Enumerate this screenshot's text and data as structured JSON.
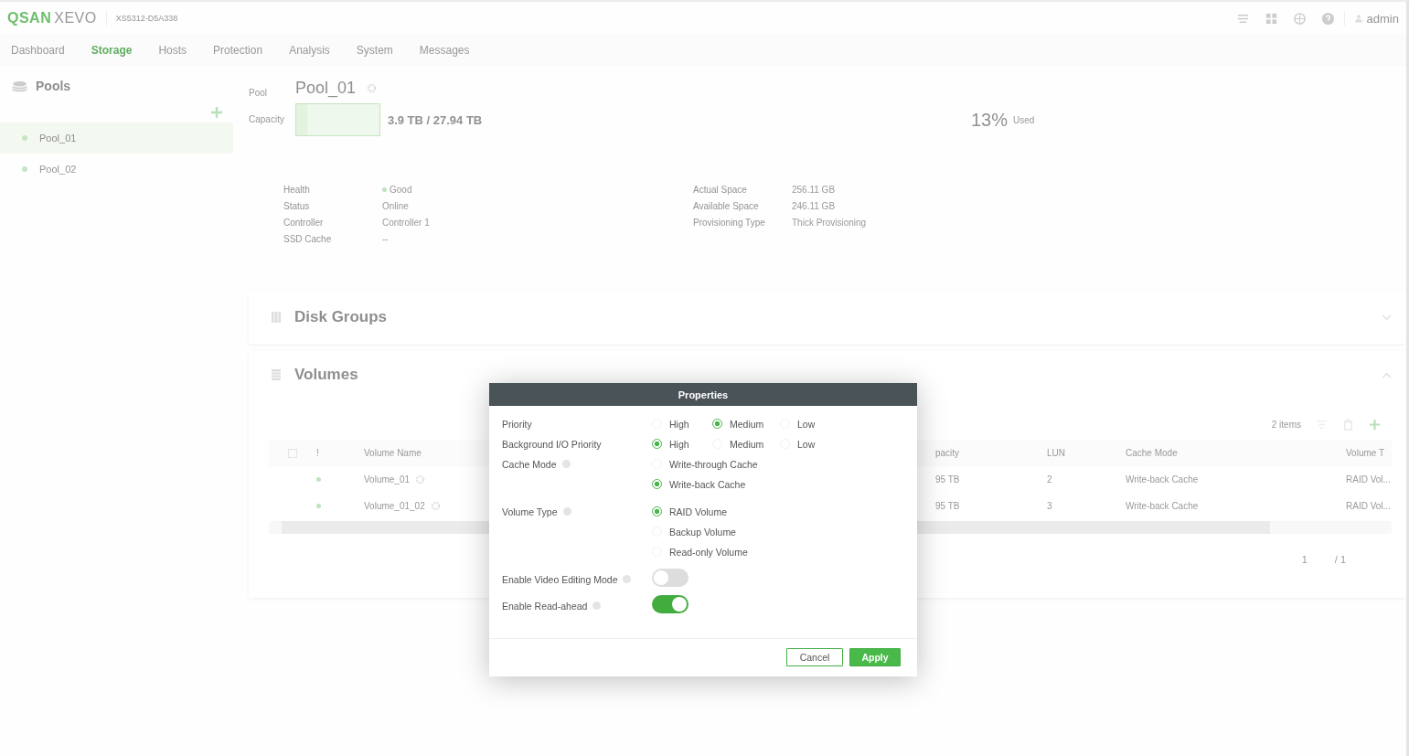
{
  "header": {
    "logo_part_1": "QSAN",
    "logo_part_2": "XEVO",
    "serial": "XS5312-D5A338",
    "user": "admin"
  },
  "nav": [
    {
      "label": "Dashboard",
      "selected": false
    },
    {
      "label": "Storage",
      "selected": true
    },
    {
      "label": "Hosts",
      "selected": false
    },
    {
      "label": "Protection",
      "selected": false
    },
    {
      "label": "Analysis",
      "selected": false
    },
    {
      "label": "System",
      "selected": false
    },
    {
      "label": "Messages",
      "selected": false
    }
  ],
  "sidebar": {
    "title": "Pools",
    "items": [
      {
        "label": "Pool_01",
        "selected": true
      },
      {
        "label": "Pool_02",
        "selected": false
      }
    ]
  },
  "pool": {
    "label": "Pool",
    "name": "Pool_01",
    "capacity_label": "Capacity",
    "level": 0.13,
    "capacity_text": "3.9 TB / 27.94 TB",
    "percent": "13%",
    "used_label": "Used",
    "details_left": [
      {
        "label": "Health",
        "value": "Good",
        "kind": "status"
      },
      {
        "label": "Status",
        "value": "Online",
        "kind": "text"
      },
      {
        "label": "Controller",
        "value": "Controller 1",
        "kind": "text"
      },
      {
        "label": "SSD Cache",
        "value": "--",
        "kind": "text"
      }
    ],
    "details_right": [
      {
        "label": "Actual Space",
        "value": "256.11 GB"
      },
      {
        "label": "Available Space",
        "value": "246.11 GB"
      },
      {
        "label": "Provisioning Type",
        "value": "Thick Provisioning"
      }
    ]
  },
  "disk_groups": {
    "title": "Disk Groups",
    "expanded": false
  },
  "volumes": {
    "title": "Volumes",
    "expanded": true,
    "item_count": "2 items",
    "select_all_checked": false,
    "columns": [
      "!",
      "Volume Name",
      "pacity",
      "LUN",
      "Cache Mode",
      "Volume T"
    ],
    "rows": [
      {
        "name": "Volume_01",
        "capacity": "95 TB",
        "lun": "2",
        "cache_mode": "Write-back Cache",
        "volume_type": "RAID Vol..."
      },
      {
        "name": "Volume_01_02",
        "capacity": "95 TB",
        "lun": "3",
        "cache_mode": "Write-back Cache",
        "volume_type": "RAID Vol..."
      }
    ],
    "page": "1",
    "page_total": "/ 1"
  },
  "dialog": {
    "title": "Properties",
    "fields": [
      {
        "kind": "radio-row",
        "label": "Priority",
        "help": false,
        "options": [
          {
            "label": "High",
            "selected": false
          },
          {
            "label": "Medium",
            "selected": true
          },
          {
            "label": "Low",
            "selected": false
          }
        ]
      },
      {
        "kind": "radio-row",
        "label": "Background I/O Priority",
        "help": false,
        "options": [
          {
            "label": "High",
            "selected": true
          },
          {
            "label": "Medium",
            "selected": false
          },
          {
            "label": "Low",
            "selected": false
          }
        ]
      },
      {
        "kind": "radio-column",
        "label": "Cache Mode",
        "help": true,
        "options": [
          {
            "label": "Write-through Cache",
            "selected": false
          },
          {
            "label": "Write-back Cache",
            "selected": true
          }
        ]
      },
      {
        "kind": "radio-column",
        "label": "Volume Type",
        "help": true,
        "options": [
          {
            "label": "RAID Volume",
            "selected": true
          },
          {
            "label": "Backup Volume",
            "selected": false
          },
          {
            "label": "Read-only Volume",
            "selected": false
          }
        ]
      },
      {
        "kind": "toggle",
        "label": "Enable Video Editing Mode",
        "help": true,
        "on": false
      },
      {
        "kind": "toggle",
        "label": "Enable Read-ahead",
        "help": true,
        "on": true
      }
    ],
    "buttons": [
      {
        "label": "Cancel",
        "kind": "secondary"
      },
      {
        "label": "Apply",
        "kind": "primary"
      }
    ]
  }
}
